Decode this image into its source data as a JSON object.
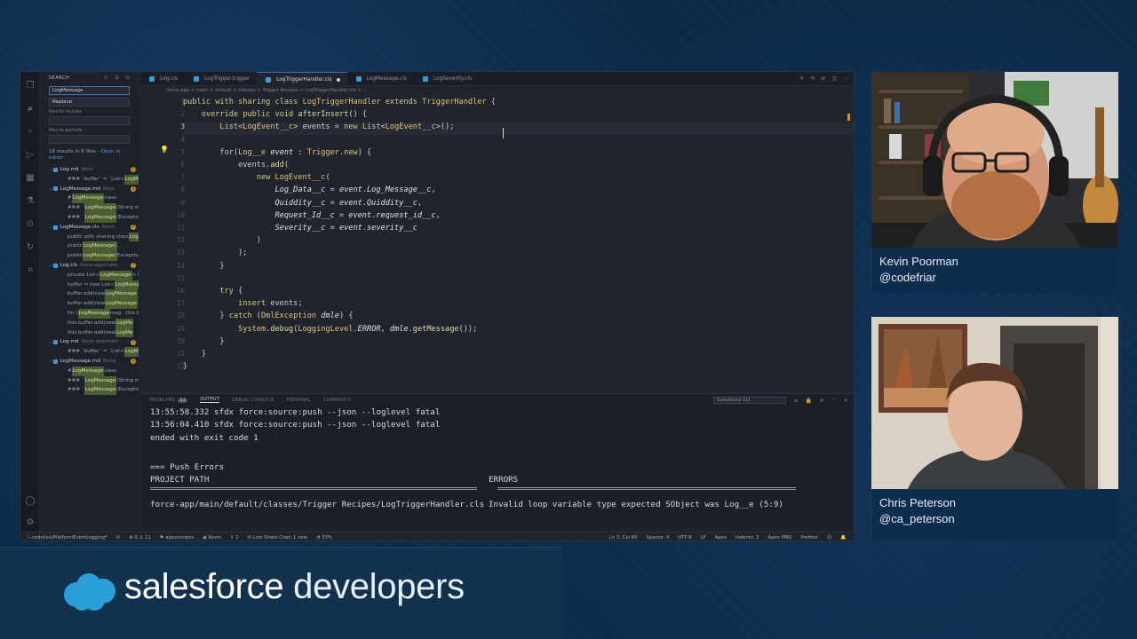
{
  "sidebar": {
    "header": "SEARCH",
    "search_value": "LogMessage",
    "replace_placeholder": "Replace",
    "include_label": "files to include",
    "exclude_label": "files to exclude",
    "results_summary": "18 results in 6 files - ",
    "open_editor": "Open in editor",
    "rows": [
      {
        "type": "file",
        "name": "Log.md",
        "path": "docs",
        "count": "1"
      },
      {
        "type": "match",
        "pre": "### `buffer` = `List<",
        "hl": "LogMes",
        "post": ""
      },
      {
        "type": "file",
        "name": "LogMessage.md",
        "path": "docs",
        "count": "3"
      },
      {
        "type": "match",
        "pre": "# ",
        "hl": "LogMessage",
        "post": " class"
      },
      {
        "type": "match",
        "pre": "### `",
        "hl": "LogMessage",
        "post": "(String mes"
      },
      {
        "type": "match",
        "pre": "### `",
        "hl": "LogMessage",
        "post": "(Exception e"
      },
      {
        "type": "file",
        "name": "LogMessage.cls",
        "path": "force-",
        "count": "3"
      },
      {
        "type": "match",
        "pre": "public with sharing class ",
        "hl": "Log",
        "post": ""
      },
      {
        "type": "match",
        "pre": "public ",
        "hl": "LogMessage(",
        "post": "..."
      },
      {
        "type": "match",
        "pre": "public ",
        "hl": "LogMessage(",
        "post": "Exception"
      },
      {
        "type": "file",
        "name": "Log.cls",
        "path": "force-app/main",
        "count": "7"
      },
      {
        "type": "match",
        "pre": "private List<",
        "hl": "LogMessage",
        "post": "> bu"
      },
      {
        "type": "match",
        "pre": "buffer = new List<",
        "hl": "LogMessag",
        "post": ""
      },
      {
        "type": "match",
        "pre": "buffer.add(new ",
        "hl": "LogMessage",
        "post": ""
      },
      {
        "type": "match",
        "pre": "buffer.add(new ",
        "hl": "LogMessage",
        "post": ""
      },
      {
        "type": "match",
        "pre": "for (",
        "hl": "LogMessage",
        "post": " msg : this.b"
      },
      {
        "type": "match",
        "pre": "this.buffer.add(new ",
        "hl": "LogMe",
        "post": ""
      },
      {
        "type": "match",
        "pre": "this.buffer.add(new ",
        "hl": "LogMe",
        "post": ""
      },
      {
        "type": "file",
        "name": "Log.md",
        "path": "force-app/main",
        "count": "1"
      },
      {
        "type": "match",
        "pre": "### `buffer` = `List<",
        "hl": "LogMes",
        "post": ""
      },
      {
        "type": "file",
        "name": "LogMessage.md",
        "path": "force",
        "count": "3"
      },
      {
        "type": "match",
        "pre": "# ",
        "hl": "LogMessage",
        "post": " class"
      },
      {
        "type": "match",
        "pre": "### `",
        "hl": "LogMessage",
        "post": "(String mes"
      },
      {
        "type": "match",
        "pre": "### `",
        "hl": "LogMessage",
        "post": "(Exception e"
      }
    ]
  },
  "tabs": [
    {
      "label": "Log.cls",
      "active": false
    },
    {
      "label": "LogTrigger.trigger",
      "active": false
    },
    {
      "label": "LogTriggerHandler.cls",
      "active": true,
      "dirty": true
    },
    {
      "label": "LogMessage.cls",
      "active": false
    },
    {
      "label": "LogSeverity.cls",
      "active": false
    }
  ],
  "breadcrumb": "force-app > main > default > classes > Trigger Recipes > LogTriggerHandler.cls > ...",
  "code_lines": [
    {
      "n": "1",
      "t": "public with sharing class LogTriggerHandler extends TriggerHandler {"
    },
    {
      "n": "2",
      "t": "    override public void afterInsert() {"
    },
    {
      "n": "3",
      "t": "        List<LogEvent__c> events = new List<LogEvent__c>();"
    },
    {
      "n": "4",
      "t": ""
    },
    {
      "n": "5",
      "t": "        for(Log__e event : Trigger.new) {"
    },
    {
      "n": "6",
      "t": "            events.add("
    },
    {
      "n": "7",
      "t": "                new LogEvent__c("
    },
    {
      "n": "8",
      "t": "                    Log_Data__c = event.Log_Message__c,"
    },
    {
      "n": "9",
      "t": "                    Quiddity__c = event.Quiddity__c,"
    },
    {
      "n": "10",
      "t": "                    Request_Id__c = event.request_id__c,"
    },
    {
      "n": "11",
      "t": "                    Severity__c = event.severity__c"
    },
    {
      "n": "12",
      "t": "                )"
    },
    {
      "n": "13",
      "t": "            );"
    },
    {
      "n": "14",
      "t": "        }"
    },
    {
      "n": "15",
      "t": ""
    },
    {
      "n": "16",
      "t": "        try {"
    },
    {
      "n": "17",
      "t": "            insert events;"
    },
    {
      "n": "18",
      "t": "        } catch (DmlException dmle) {"
    },
    {
      "n": "19",
      "t": "            System.debug(LoggingLevel.ERROR, dmle.getMessage());"
    },
    {
      "n": "20",
      "t": "        }"
    },
    {
      "n": "21",
      "t": "    }"
    },
    {
      "n": "22",
      "t": "}"
    }
  ],
  "panel": {
    "tabs": [
      "PROBLEMS",
      "OUTPUT",
      "DEBUG CONSOLE",
      "TERMINAL",
      "COMMENTS"
    ],
    "problems_count": "12",
    "selected_channel": "Salesforce CLI",
    "output": [
      "13:55:58.332 sfdx force:source:push --json --loglevel fatal",
      "13:56:04.410 sfdx force:source:push --json --loglevel fatal",
      "ended with exit code 1"
    ],
    "push_errors": "=== Push Errors",
    "col1": "PROJECT PATH",
    "col2": "ERRORS",
    "err_path": "force-app/main/default/classes/Trigger Recipes/LogTriggerHandler.cls",
    "err_msg": "Invalid loop variable type expected SObject was Log__e (5:9)"
  },
  "statusbar": {
    "branch": "codelive/PlatformEventLogging*",
    "errors": "0",
    "warnings": "11",
    "org": "apexrecipes",
    "user": "Kevin",
    "chat": "Live Share Chat: 1 new",
    "progress": "33%",
    "position": "Ln 3, Col 60",
    "spaces": "Spaces: 4",
    "encoding": "UTF-8",
    "eol": "LF",
    "lang": "Apex",
    "indents": "Indents: 2",
    "pmd": "Apex PMD",
    "prettier": "Prettier"
  },
  "cams": [
    {
      "name": "Kevin Poorman",
      "handle": "@codefriar"
    },
    {
      "name": "Chris Peterson",
      "handle": "@ca_peterson"
    }
  ],
  "brand": {
    "bold": "salesforce",
    "light": " developers"
  },
  "colors": {
    "background": "#0c2947",
    "accent": "#3a6fb5",
    "cloud": "#2a9fd8",
    "highlight": "#4b5f2e"
  }
}
